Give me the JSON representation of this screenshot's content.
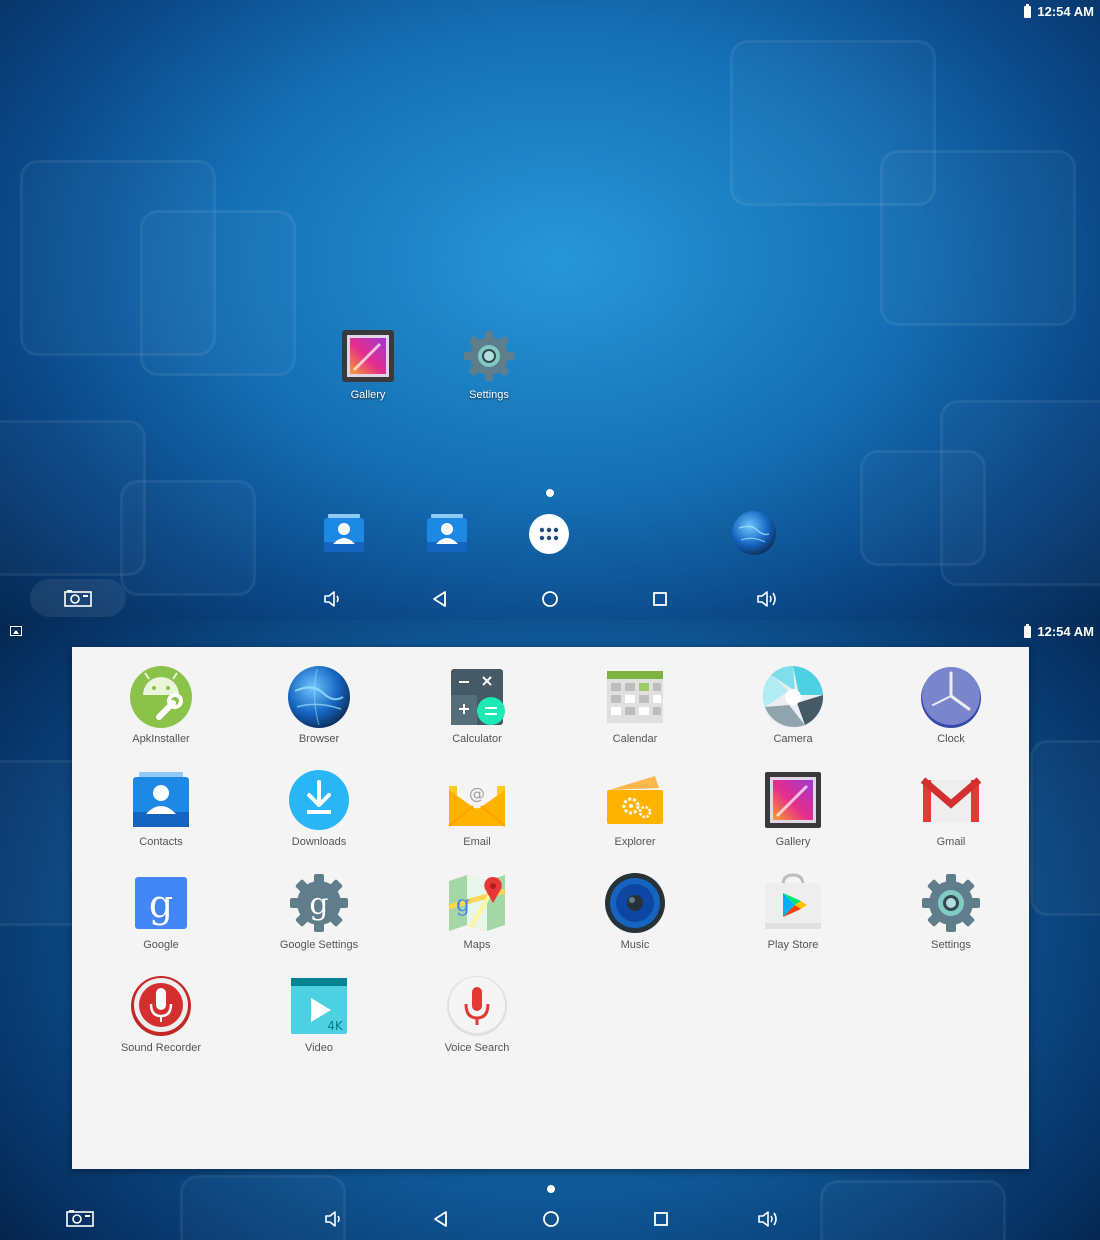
{
  "status": {
    "time": "12:54 AM"
  },
  "home": {
    "apps": [
      {
        "label": "Gallery",
        "icon": "gallery-icon"
      },
      {
        "label": "Settings",
        "icon": "settings-icon"
      }
    ],
    "dock": [
      "contacts-icon",
      "contacts-icon",
      "all-apps-icon",
      "browser-icon"
    ]
  },
  "drawer": {
    "apps": [
      {
        "label": "ApkInstaller",
        "icon": "apk-installer-icon"
      },
      {
        "label": "Browser",
        "icon": "browser-icon"
      },
      {
        "label": "Calculator",
        "icon": "calculator-icon"
      },
      {
        "label": "Calendar",
        "icon": "calendar-icon"
      },
      {
        "label": "Camera",
        "icon": "camera-icon"
      },
      {
        "label": "Clock",
        "icon": "clock-icon"
      },
      {
        "label": "Contacts",
        "icon": "contacts-icon"
      },
      {
        "label": "Downloads",
        "icon": "downloads-icon"
      },
      {
        "label": "Email",
        "icon": "email-icon"
      },
      {
        "label": "Explorer",
        "icon": "explorer-icon"
      },
      {
        "label": "Gallery",
        "icon": "gallery-icon"
      },
      {
        "label": "Gmail",
        "icon": "gmail-icon"
      },
      {
        "label": "Google",
        "icon": "google-icon"
      },
      {
        "label": "Google Settings",
        "icon": "google-settings-icon"
      },
      {
        "label": "Maps",
        "icon": "maps-icon"
      },
      {
        "label": "Music",
        "icon": "music-icon"
      },
      {
        "label": "Play Store",
        "icon": "play-store-icon"
      },
      {
        "label": "Settings",
        "icon": "settings-icon"
      },
      {
        "label": "Sound Recorder",
        "icon": "sound-recorder-icon"
      },
      {
        "label": "Video",
        "icon": "video-icon"
      },
      {
        "label": "Voice Search",
        "icon": "voice-search-icon"
      }
    ]
  },
  "colors": {
    "accent": "#1e8fd6",
    "drawer_bg": "#f4f4f4",
    "label": "#555555"
  }
}
